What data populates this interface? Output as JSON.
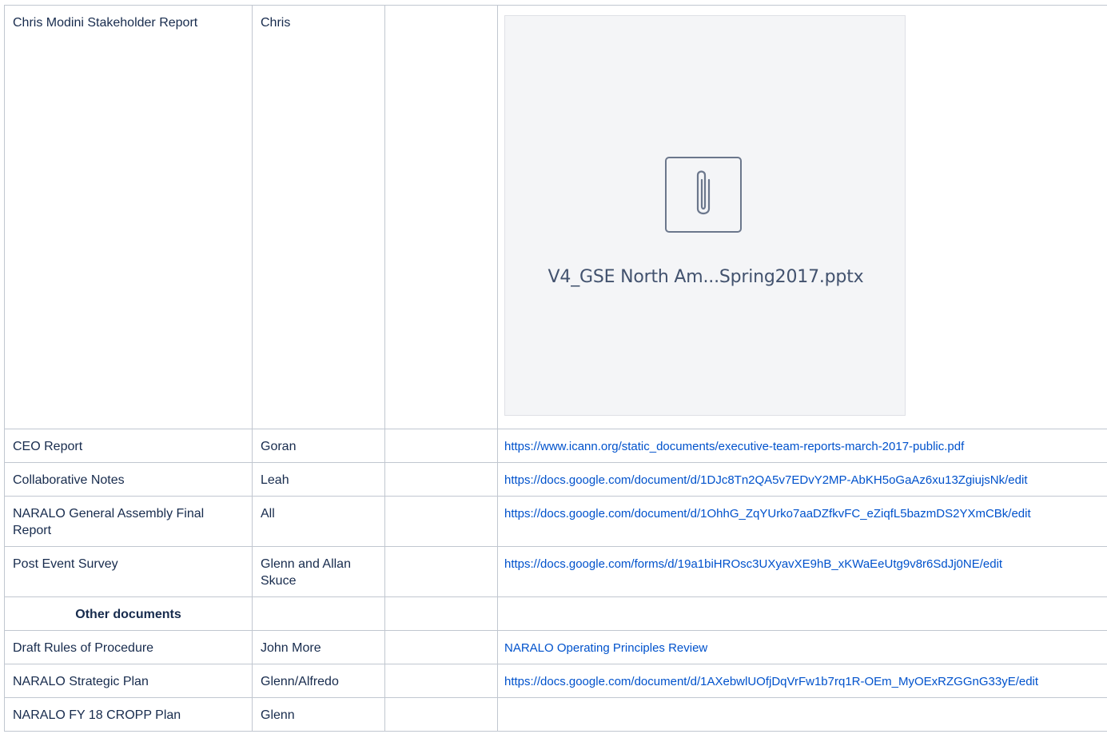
{
  "rows": [
    {
      "item": "Chris Modini Stakeholder Report",
      "owner": "Chris",
      "notes": "",
      "attachment": {
        "filename": "V4_GSE North Am...Spring2017.pptx",
        "icon": "paperclip-icon"
      }
    },
    {
      "item": "CEO Report",
      "owner": "Goran",
      "notes": "",
      "link": "https://www.icann.org/static_documents/executive-team-reports-march-2017-public.pdf"
    },
    {
      "item": "Collaborative Notes",
      "owner": "Leah",
      "notes": "",
      "link": "https://docs.google.com/document/d/1DJc8Tn2QA5v7EDvY2MP-AbKH5oGaAz6xu13ZgiujsNk/edit"
    },
    {
      "item": "NARALO General Assembly  Final Report",
      "owner": "All",
      "notes": "",
      "link": "https://docs.google.com/document/d/1OhhG_ZqYUrko7aaDZfkvFC_eZiqfL5bazmDS2YXmCBk/edit"
    },
    {
      "item": "Post Event Survey",
      "owner": "Glenn and Allan Skuce",
      "notes": "",
      "link": "https://docs.google.com/forms/d/19a1biHROsc3UXyavXE9hB_xKWaEeUtg9v8r6SdJj0NE/edit"
    }
  ],
  "section_heading": "Other documents",
  "other_rows": [
    {
      "item": "Draft  Rules of Procedure",
      "owner": "John More",
      "notes": "",
      "link": "NARALO Operating Principles Review"
    },
    {
      "item": "NARALO Strategic Plan",
      "owner": "Glenn/Alfredo",
      "notes": "",
      "link": "https://docs.google.com/document/d/1AXebwlUOfjDqVrFw1b7rq1R-OEm_MyOExRZGGnG33yE/edit"
    },
    {
      "item": "NARALO FY 18 CROPP Plan",
      "owner": "Glenn",
      "notes": "",
      "link": ""
    }
  ],
  "colors": {
    "link": "#0052cc",
    "border": "#c1c7d0",
    "attachment_bg": "#f4f5f7"
  }
}
